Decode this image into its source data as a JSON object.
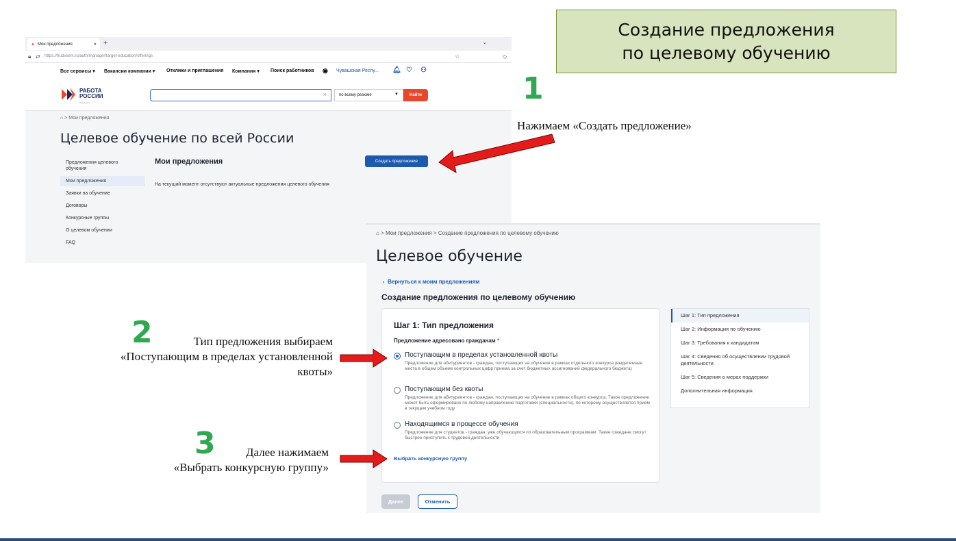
{
  "slide": {
    "title_line1": "Создание предложения",
    "title_line2": "по целевому обучению"
  },
  "annotations": {
    "step1_num": "1",
    "step1_text": "Нажимаем «Создать предложение»",
    "step2_num": "2",
    "step2_line1": "Тип предложения  выбираем",
    "step2_line2": "«Поступающим  в пределах установленной",
    "step2_line3": "квоты»",
    "step3_num": "3",
    "step3_line1": "Далее нажимаем",
    "step3_line2": "«Выбрать конкурсную  группу»"
  },
  "shot1": {
    "tab_title": "Мои предложения",
    "url": "https://trudvsem.ru/auth/manager/target-education/offerings",
    "nav": [
      "Все сервисы ▾",
      "Вакансии компании ▾",
      "Отклики и приглашения",
      "Компания ▾",
      "Поиск работников",
      "Чувашская Респу..."
    ],
    "logo_line1": "РАБОТА",
    "logo_line2": "РОССИИ",
    "logo_sub": "trudvsem.ru",
    "search_scope": "по всему резюме",
    "search_button": "Найти",
    "breadcrumb": "⌂  >  Мои предложения",
    "page_title": "Целевое обучение по всей России",
    "side_items": [
      "Предложения целевого обучения",
      "Мои предложения",
      "Заявки на обучение",
      "Договоры",
      "Конкурсные группы",
      "О целевом обучении",
      "FAQ"
    ],
    "section_title": "Мои предложения",
    "create_button": "Создать предложение",
    "empty_text": "На текущий момент отсутствуют актуальные предложения целевого обучения"
  },
  "shot2": {
    "breadcrumb": "⌂  >  Мои предложения  >  Создание предложения по целевому обучению",
    "page_title": "Целевое обучение",
    "back_link": "Вернуться к моим предложениям",
    "subtitle": "Создание предложения по целевому обучению",
    "step_title": "Шаг 1: Тип предложения",
    "address_label": "Предложение адресовано гражданам",
    "required_mark": "*",
    "options": [
      {
        "title": "Поступающим в пределах установленной квоты",
        "desc": "Предложение для абитуриентов - граждан, поступающих на обучение в рамках отдельного конкурса (выделенные места в общем объеме контрольных цифр приема за счет бюджетных ассигнований федерального бюджета)",
        "selected": true
      },
      {
        "title": "Поступающим без квоты",
        "desc": "Предложение для абитуриентов - граждан, поступающих на обучение в рамках общего конкурса. Такое предложение может быть сформировано по любому направлению подготовки (специальности), по которому осуществляется прием в текущем учебном году",
        "selected": false
      },
      {
        "title": "Находящимся в процессе обучения",
        "desc": "Предложение для студентов - граждан, уже обучающихся по образовательным программам. Такие граждане смогут быстрее приступить к трудовой деятельности",
        "selected": false
      }
    ],
    "pick_group": "Выбрать конкурсную группу",
    "steps": [
      "Шаг 1: Тип предложения",
      "Шаг 2: Информация по обучению",
      "Шаг 3: Требования к кандидатам",
      "Шаг 4: Сведения об осуществлении трудовой деятельности",
      "Шаг 5: Сведения о мерах поддержки",
      "Дополнительная информация"
    ],
    "next_button": "Далее",
    "cancel_button": "Отменить"
  }
}
